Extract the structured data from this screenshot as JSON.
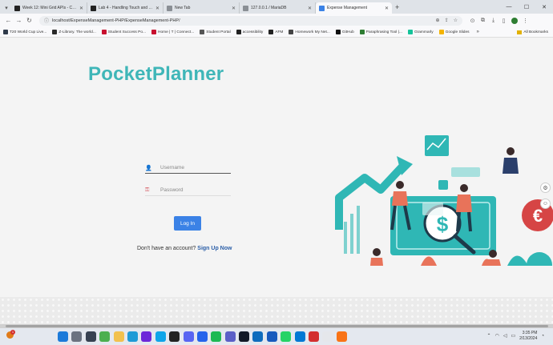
{
  "browser": {
    "tabs": [
      {
        "title": "Week 12: Mini Grid APIs - CS511 Fa...",
        "fav_color": "#222222",
        "active": false
      },
      {
        "title": "Lab 4 - Handling Touch and Acce...",
        "fav_color": "#222222",
        "active": false
      },
      {
        "title": "New Tab",
        "fav_color": "#8a8f95",
        "active": false
      },
      {
        "title": "127.0.0.1 / MariaDB",
        "fav_color": "#8a8f95",
        "active": false
      },
      {
        "title": "Expense Management",
        "fav_color": "#3b82e6",
        "active": true
      }
    ],
    "new_tab_glyph": "+",
    "url": "localhost/ExpenseManagement-PHP/ExpenseManagement-PHP/",
    "bookmarks": [
      {
        "label": "T20 World Cup Live...",
        "color": "#2f3a4a"
      },
      {
        "label": "Z-Library. The world...",
        "color": "#2a2a2a"
      },
      {
        "label": "Student Success Po...",
        "color": "#c8102e"
      },
      {
        "label": "Home | T | Connect...",
        "color": "#c8102e"
      },
      {
        "label": "Student Portal",
        "color": "#555555"
      },
      {
        "label": "accessibility",
        "color": "#222222"
      },
      {
        "label": "AFM",
        "color": "#222222"
      },
      {
        "label": "Homework My Net...",
        "color": "#444444"
      },
      {
        "label": "GitHub",
        "color": "#111111"
      },
      {
        "label": "Paraphrasing Tool |...",
        "color": "#2e7d32"
      },
      {
        "label": "Grammarly",
        "color": "#15c39a"
      },
      {
        "label": "Google Slides",
        "color": "#f4b400"
      }
    ],
    "all_bookmarks": "All Bookmarks"
  },
  "page": {
    "brand": "PocketPlanner",
    "username_placeholder": "Username",
    "password_placeholder": "Password",
    "login_label": "Log In",
    "signup_prompt": "Don't have an account?",
    "signup_link": "Sign Up Now"
  },
  "taskbar": {
    "weather_badge": "1",
    "apps": [
      {
        "icon": "windows-start-icon",
        "color": "#1c7ad9"
      },
      {
        "icon": "search-icon",
        "color": "#6b7280"
      },
      {
        "icon": "task-view-icon",
        "color": "#374151"
      },
      {
        "icon": "chrome-icon",
        "color": "#4caf50"
      },
      {
        "icon": "folder-icon",
        "color": "#f2c14e"
      },
      {
        "icon": "edge-icon",
        "color": "#1f9bd6"
      },
      {
        "icon": "app-icon",
        "color": "#6d28d9"
      },
      {
        "icon": "store-icon",
        "color": "#0ea5e9"
      },
      {
        "icon": "github-icon",
        "color": "#222222"
      },
      {
        "icon": "discord-icon",
        "color": "#5865f2"
      },
      {
        "icon": "app-icon",
        "color": "#2563eb"
      },
      {
        "icon": "spotify-icon",
        "color": "#1db954"
      },
      {
        "icon": "teams-icon",
        "color": "#5b5fc7"
      },
      {
        "icon": "app-icon",
        "color": "#111827"
      },
      {
        "icon": "outlook-icon",
        "color": "#0f6cbd"
      },
      {
        "icon": "word-icon",
        "color": "#185abd"
      },
      {
        "icon": "whatsapp-icon",
        "color": "#25d366"
      },
      {
        "icon": "vscode-icon",
        "color": "#0078d4"
      },
      {
        "icon": "acrobat-icon",
        "color": "#d32f2f"
      },
      {
        "icon": "app-icon",
        "color": "#e5e7eb"
      },
      {
        "icon": "xampp-icon",
        "color": "#f97316"
      }
    ],
    "time": "3:35 PM",
    "date": "2/13/2024"
  }
}
